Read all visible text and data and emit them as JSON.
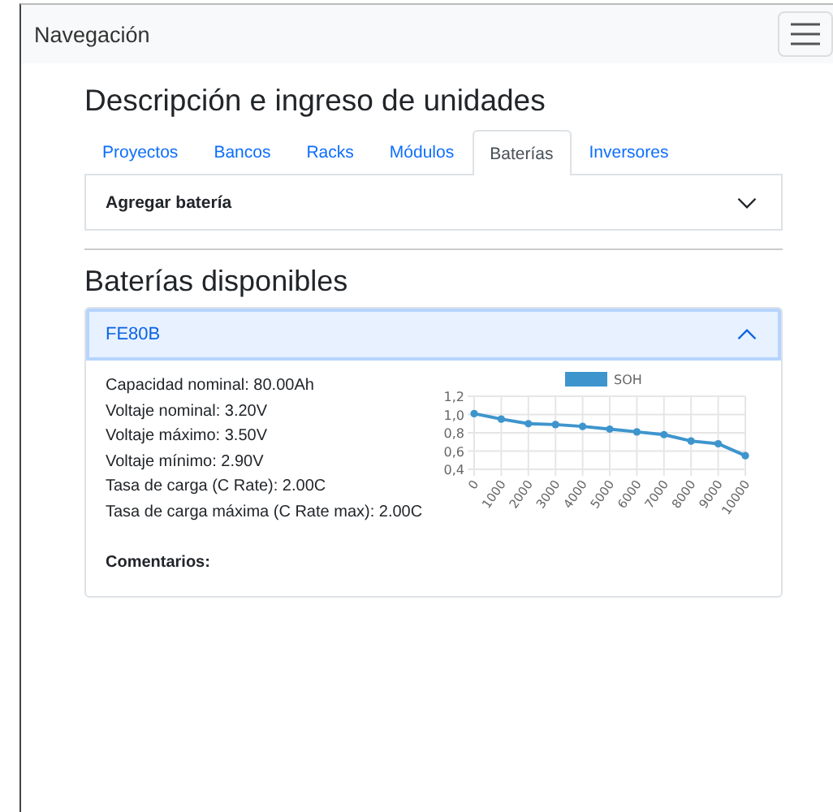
{
  "navbar": {
    "brand": "Navegación"
  },
  "page_title": "Descripción e ingreso de unidades",
  "tabs": [
    {
      "label": "Proyectos",
      "selected": false
    },
    {
      "label": "Bancos",
      "selected": false
    },
    {
      "label": "Racks",
      "selected": false
    },
    {
      "label": "Módulos",
      "selected": false
    },
    {
      "label": "Baterías",
      "selected": true
    },
    {
      "label": "Inversores",
      "selected": false
    }
  ],
  "add_panel": {
    "title": "Agregar batería",
    "expanded": false
  },
  "section_title": "Baterías disponibles",
  "batteries": [
    {
      "name": "FE80B",
      "expanded": true,
      "specs": [
        "Capacidad nominal: 80.00Ah",
        "Voltaje nominal: 3.20V",
        "Voltaje máximo: 3.50V",
        "Voltaje mínimo: 2.90V",
        "Tasa de carga (C Rate): 2.00C",
        "Tasa de carga máxima (C Rate max): 2.00C"
      ],
      "comments_label": "Comentarios:",
      "chart_data": {
        "type": "line",
        "grid": true,
        "categories": [
          "0",
          "1000",
          "2000",
          "3000",
          "4000",
          "5000",
          "6000",
          "7000",
          "8000",
          "9000",
          "10000"
        ],
        "series": [
          {
            "name": "SOH",
            "color": "#3e95cd",
            "marker": true,
            "values": [
              1.01,
              0.95,
              0.9,
              0.89,
              0.87,
              0.84,
              0.81,
              0.78,
              0.71,
              0.68,
              0.55
            ]
          }
        ],
        "ylim": [
          0.4,
          1.2
        ],
        "yticks": [
          {
            "value": 0.4,
            "label": "0,4"
          },
          {
            "value": 0.6,
            "label": "0,6"
          },
          {
            "value": 0.8,
            "label": "0,8"
          },
          {
            "value": 1.0,
            "label": "1,0"
          },
          {
            "value": 1.2,
            "label": "1,2"
          }
        ]
      }
    }
  ]
}
